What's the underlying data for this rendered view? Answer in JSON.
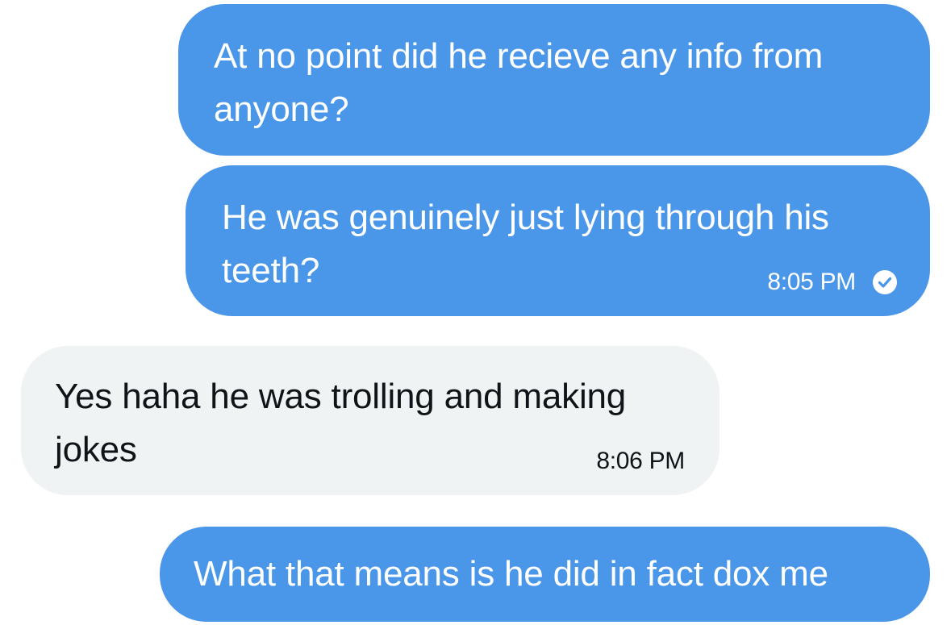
{
  "messages": [
    {
      "direction": "sent",
      "lines": [
        "At no point did he recieve any info from",
        "anyone?"
      ],
      "time": "",
      "read": false
    },
    {
      "direction": "sent",
      "lines": [
        "He was genuinely just lying through his",
        "teeth?"
      ],
      "time": "8:05 PM",
      "read": true
    },
    {
      "direction": "received",
      "lines": [
        "Yes haha he was trolling and making",
        "jokes"
      ],
      "time": "8:06 PM",
      "read": false
    },
    {
      "direction": "sent",
      "lines": [
        "What that means is he did in fact dox me"
      ],
      "time": "",
      "read": false
    }
  ],
  "colors": {
    "sent_bubble": "#4a97e9",
    "received_bubble": "#eff3f4",
    "received_text": "#0f1419"
  },
  "icons": {
    "read_receipt": "check-circle-icon"
  }
}
